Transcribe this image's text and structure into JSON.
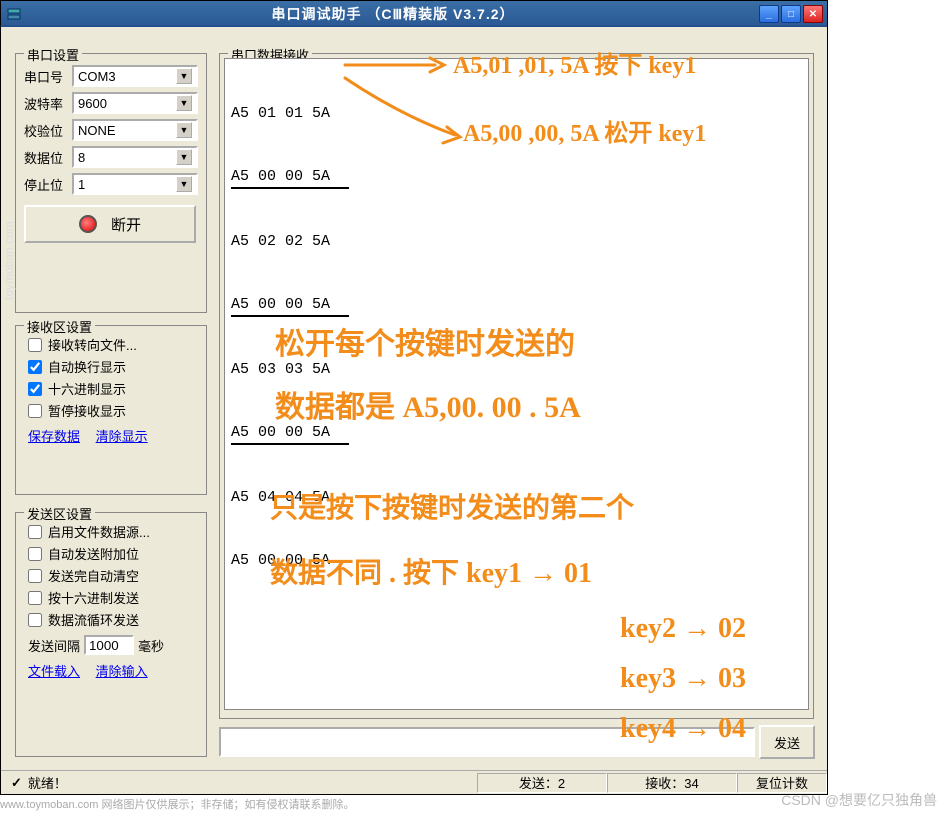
{
  "window": {
    "title": "串口调试助手 （CⅢ精装版 V3.7.2）"
  },
  "serial_settings": {
    "legend": "串口设置",
    "port_label": "串口号",
    "port_value": "COM3",
    "baud_label": "波特率",
    "baud_value": "9600",
    "parity_label": "校验位",
    "parity_value": "NONE",
    "data_bits_label": "数据位",
    "data_bits_value": "8",
    "stop_bits_label": "停止位",
    "stop_bits_value": "1",
    "disconnect_label": "断开"
  },
  "recv_settings": {
    "legend": "接收区设置",
    "to_file": "接收转向文件...",
    "auto_wrap": "自动换行显示",
    "hex_disp": "十六进制显示",
    "pause": "暂停接收显示",
    "save_link": "保存数据",
    "clear_link": "清除显示"
  },
  "send_settings": {
    "legend": "发送区设置",
    "file_source": "启用文件数据源...",
    "auto_append": "自动发送附加位",
    "clear_after": "发送完自动清空",
    "hex_send": "按十六进制发送",
    "loop_send": "数据流循环发送",
    "interval_label": "发送间隔",
    "interval_value": "1000",
    "interval_unit": "毫秒",
    "load_file_link": "文件载入",
    "clear_input_link": "清除输入"
  },
  "data_recv": {
    "legend": "串口数据接收",
    "lines": [
      "A5 01 01 5A",
      "A5 00 00 5A",
      "A5 02 02 5A",
      "A5 00 00 5A",
      "A5 03 03 5A",
      "A5 00 00 5A",
      "A5 04 04 5A",
      "A5 00 00 5A"
    ]
  },
  "bottom": {
    "send_button": "发送"
  },
  "statusbar": {
    "ready_icon": "✓",
    "ready": "就绪！",
    "send_count": "发送：2",
    "recv_count": "接收：34",
    "reset": "复位计数"
  },
  "annotations": {
    "line1_press": "A5,01 ,01, 5A    按下 key1",
    "line2_release": "A5,00 ,00,  5A   松开 key1",
    "note1_l1": "松开每个按键时发送的",
    "note1_l2": "数据都是 A5,00. 00 . 5A",
    "note2_l1": "只是按下按键时发送的第二个",
    "note2_l2": "数据不同 . 按下 key1 → 01",
    "note2_l3": "key2 → 02",
    "note2_l4": "key3 → 03",
    "note2_l5": "key4 → 04"
  },
  "footer": {
    "text": "www.toymoban.com 网络图片仅供展示；非存储；如有侵权请联系删除。",
    "watermark": "CSDN @想要亿只独角兽",
    "side": "toymoban.com"
  }
}
